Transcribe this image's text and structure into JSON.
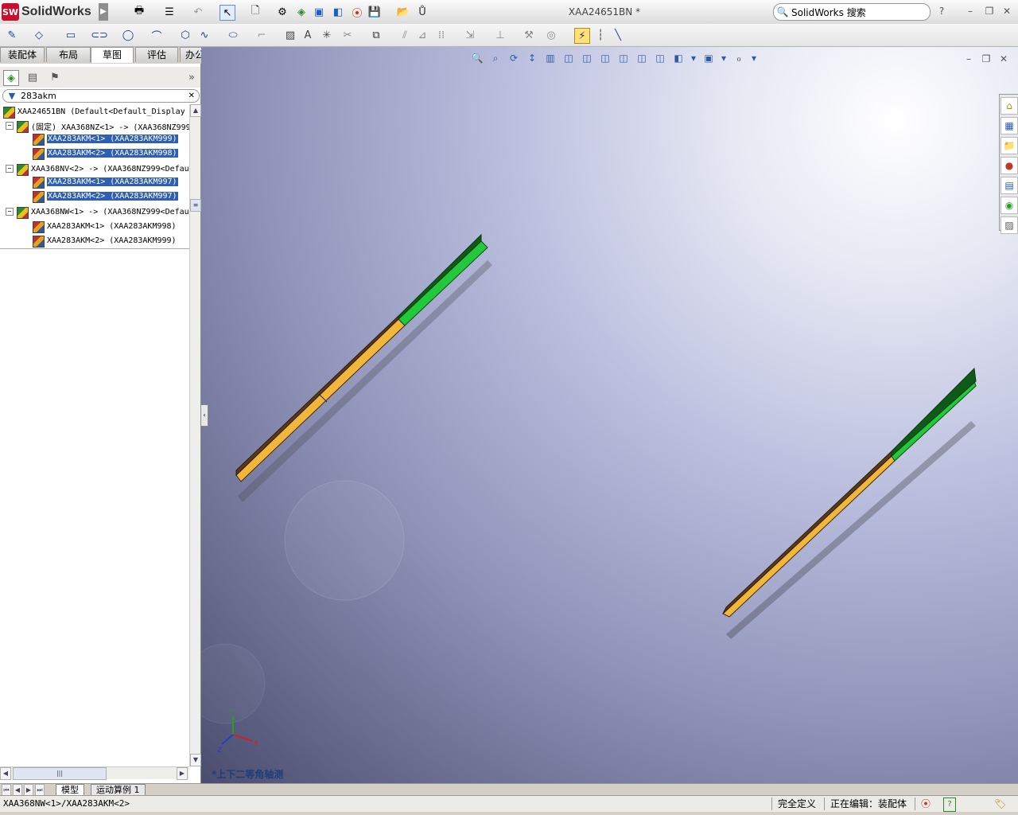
{
  "app": {
    "name": "SolidWorks",
    "logo_text": "SW"
  },
  "window": {
    "document_title": "XAA24651BN *"
  },
  "search": {
    "placeholder": "SolidWorks 搜索"
  },
  "tabs": [
    {
      "label": "装配体"
    },
    {
      "label": "布局"
    },
    {
      "label": "草图"
    },
    {
      "label": "评估"
    },
    {
      "label": "办公室产品"
    }
  ],
  "active_tab": "草图",
  "filter": {
    "value": "283akm"
  },
  "tree": {
    "root": "XAA24651BN  (Default<Default_Display",
    "groups": [
      {
        "label": "(固定) XAA368NZ<1> -> (XAA368NZ999",
        "children": [
          {
            "label": "XAA283AKM<1> (XAA283AKM999)",
            "selected": true
          },
          {
            "label": "XAA283AKM<2> (XAA283AKM998)",
            "selected": true
          }
        ]
      },
      {
        "label": "XAA368NV<2> -> (XAA368NZ999<Defau",
        "children": [
          {
            "label": "XAA283AKM<1> (XAA283AKM997)",
            "selected": true
          },
          {
            "label": "XAA283AKM<2> (XAA283AKM997)",
            "selected": true
          }
        ]
      },
      {
        "label": "XAA368NW<1> -> (XAA368NZ999<Defau",
        "children": [
          {
            "label": "XAA283AKM<1> (XAA283AKM998)",
            "selected": false
          },
          {
            "label": "XAA283AKM<2> (XAA283AKM999)",
            "selected": false
          }
        ]
      }
    ]
  },
  "viewport": {
    "view_label": "*上下二等角轴测",
    "axes": {
      "x": "X",
      "y": "Y",
      "z": "Z"
    }
  },
  "bottom_tabs": [
    {
      "label": "模型"
    },
    {
      "label": "运动算例 1"
    }
  ],
  "status": {
    "path": "XAA368NW<1>/XAA283AKM<2>",
    "definition": "完全定义",
    "editing": "正在编辑：装配体"
  },
  "colors": {
    "selection": "#2f5fb3",
    "beam_yellow": "#f2b73a",
    "beam_green": "#22c93a",
    "beam_brown": "#5a3a17"
  }
}
